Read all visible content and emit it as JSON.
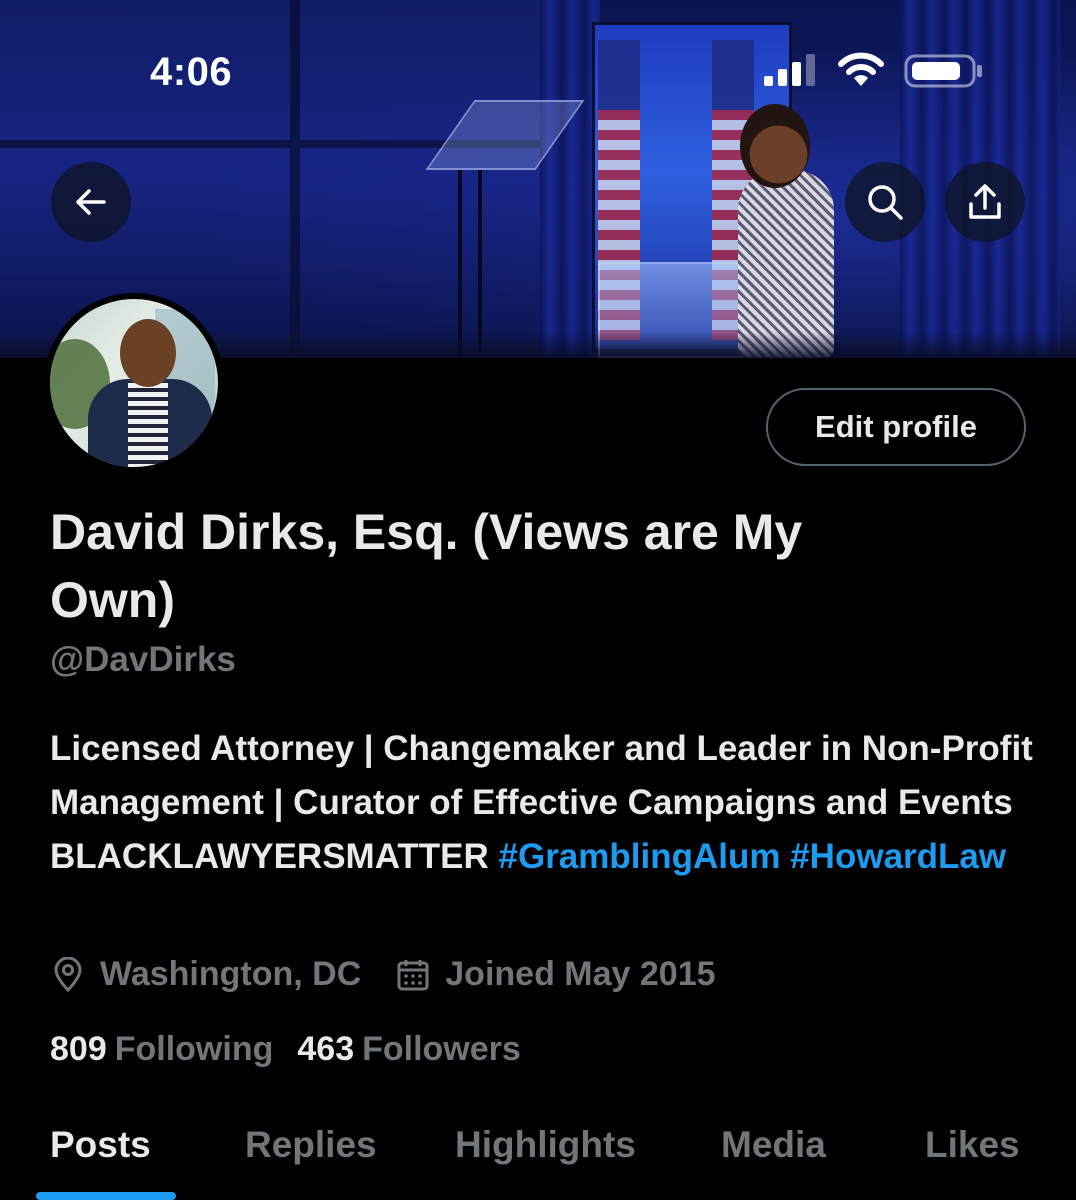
{
  "status_bar": {
    "time": "4:06"
  },
  "header": {
    "back_icon": "arrow-left-icon",
    "search_icon": "search-icon",
    "share_icon": "share-icon"
  },
  "profile": {
    "edit_button_label": "Edit profile",
    "display_name": "David Dirks, Esq. (Views are My Own)",
    "handle": "@DavDirks",
    "bio_text": "Licensed Attorney | Changemaker and Leader in Non-Profit Management | Curator of Effective Campaigns and Events BLACKLAWYERSMATTER",
    "hashtags": [
      "#GramblingAlum",
      "#HowardLaw"
    ],
    "location": "Washington, DC",
    "joined": "Joined May 2015",
    "following_count": "809",
    "following_label": "Following",
    "followers_count": "463",
    "followers_label": "Followers"
  },
  "tabs": [
    {
      "label": "Posts",
      "active": true
    },
    {
      "label": "Replies",
      "active": false
    },
    {
      "label": "Highlights",
      "active": false
    },
    {
      "label": "Media",
      "active": false
    },
    {
      "label": "Likes",
      "active": false
    }
  ],
  "colors": {
    "background": "#000000",
    "text_primary": "#e7e9ea",
    "text_secondary": "#71767b",
    "accent": "#1d9bf0",
    "button_border": "#536471"
  }
}
